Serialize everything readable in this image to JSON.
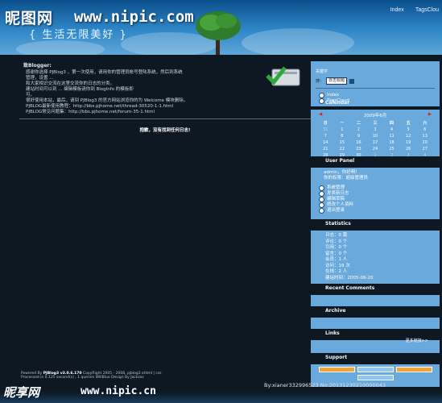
{
  "header": {
    "logo_cn": "昵图网",
    "logo_url": "www.nipic.com",
    "slogan": "{ 生活无限美好 }",
    "nav": [
      "Index",
      "TagsClou"
    ]
  },
  "main": {
    "greeting": "致Blogger:",
    "intro_lines": [
      "感谢你选择 PJBlog3 ，第一次使用，请用你的管理员帐号登陆系统，然后到系统",
      "管理，设置 ...",
      "和大家相识交流在这里交流你的日志的分类。",
      "建站时间可以到 ... 编辑模板请你到 BlogInfo 的模板即",
      "可。",
      "很好使用本站，最后，请到 PJBlog3 的官方网站浏览你的为 Welcome 模块删除。"
    ],
    "bbs_lines": [
      "PJBLOG最新使用教程：http://bbs.pjhome.net/thread-30520-1-1.html",
      "PJBLOG常见问题集：http://bbs.pjhome.net/forum-35-1.html"
    ],
    "no_article": "抱歉，没有找到任何日志!"
  },
  "sidebar": {
    "search": {
      "label": "关键字",
      "scope_label": "搜：",
      "select_value": "日志标题"
    },
    "menu_links": [
      "Index",
      "TagsCloud"
    ],
    "calendar": {
      "title": "Calendar",
      "month_label": "2009年6月",
      "prev": "◀",
      "next": "▶",
      "weekdays": [
        "日",
        "一",
        "二",
        "三",
        "四",
        "五",
        "六"
      ],
      "days": [
        "31",
        "1",
        "2",
        "3",
        "4",
        "5",
        "6",
        "7",
        "8",
        "9",
        "10",
        "11",
        "12",
        "13",
        "14",
        "15",
        "16",
        "17",
        "18",
        "19",
        "20",
        "21",
        "22",
        "23",
        "24",
        "25",
        "26",
        "27",
        "28",
        "29",
        "30",
        "1",
        "2",
        "3",
        "4"
      ]
    },
    "user_panel": {
      "title": "User Panel",
      "welcome": "admin，你好啊！",
      "role": "你的权限：超级管理员",
      "links": [
        "系统管理",
        "发表新日志",
        "编辑草稿",
        "修改个人资料",
        "退出登录"
      ]
    },
    "statistics": {
      "title": "Statistics",
      "items": [
        "日志：0 篇",
        "评论：0 个",
        "引用：0 个",
        "留言：0 个",
        "会员：1 人",
        "访问：19 次",
        "在线：2 人",
        "建站时间：2005-06-20"
      ]
    },
    "recent_comments": {
      "title": "Recent Comments"
    },
    "archive": {
      "title": "Archive"
    },
    "links": {
      "title": "Links",
      "more": "更多链接>>"
    },
    "support": {
      "title": "Support"
    }
  },
  "footer": {
    "line1_prefix": "Powered By",
    "line1_product": "PJBlog3 v3.0.6.170",
    "line1_rest": "CopyRight 2005 - 2008, pjblog3 xhtml | css",
    "line2": "Processed in 0.125 second(s) , 1 queries  WillBlue Design By Jackzoc"
  },
  "watermark": {
    "site": "昵享网",
    "url": "www.nipic.cn",
    "id": "By:xianer332996523  No:20131230210000043"
  }
}
